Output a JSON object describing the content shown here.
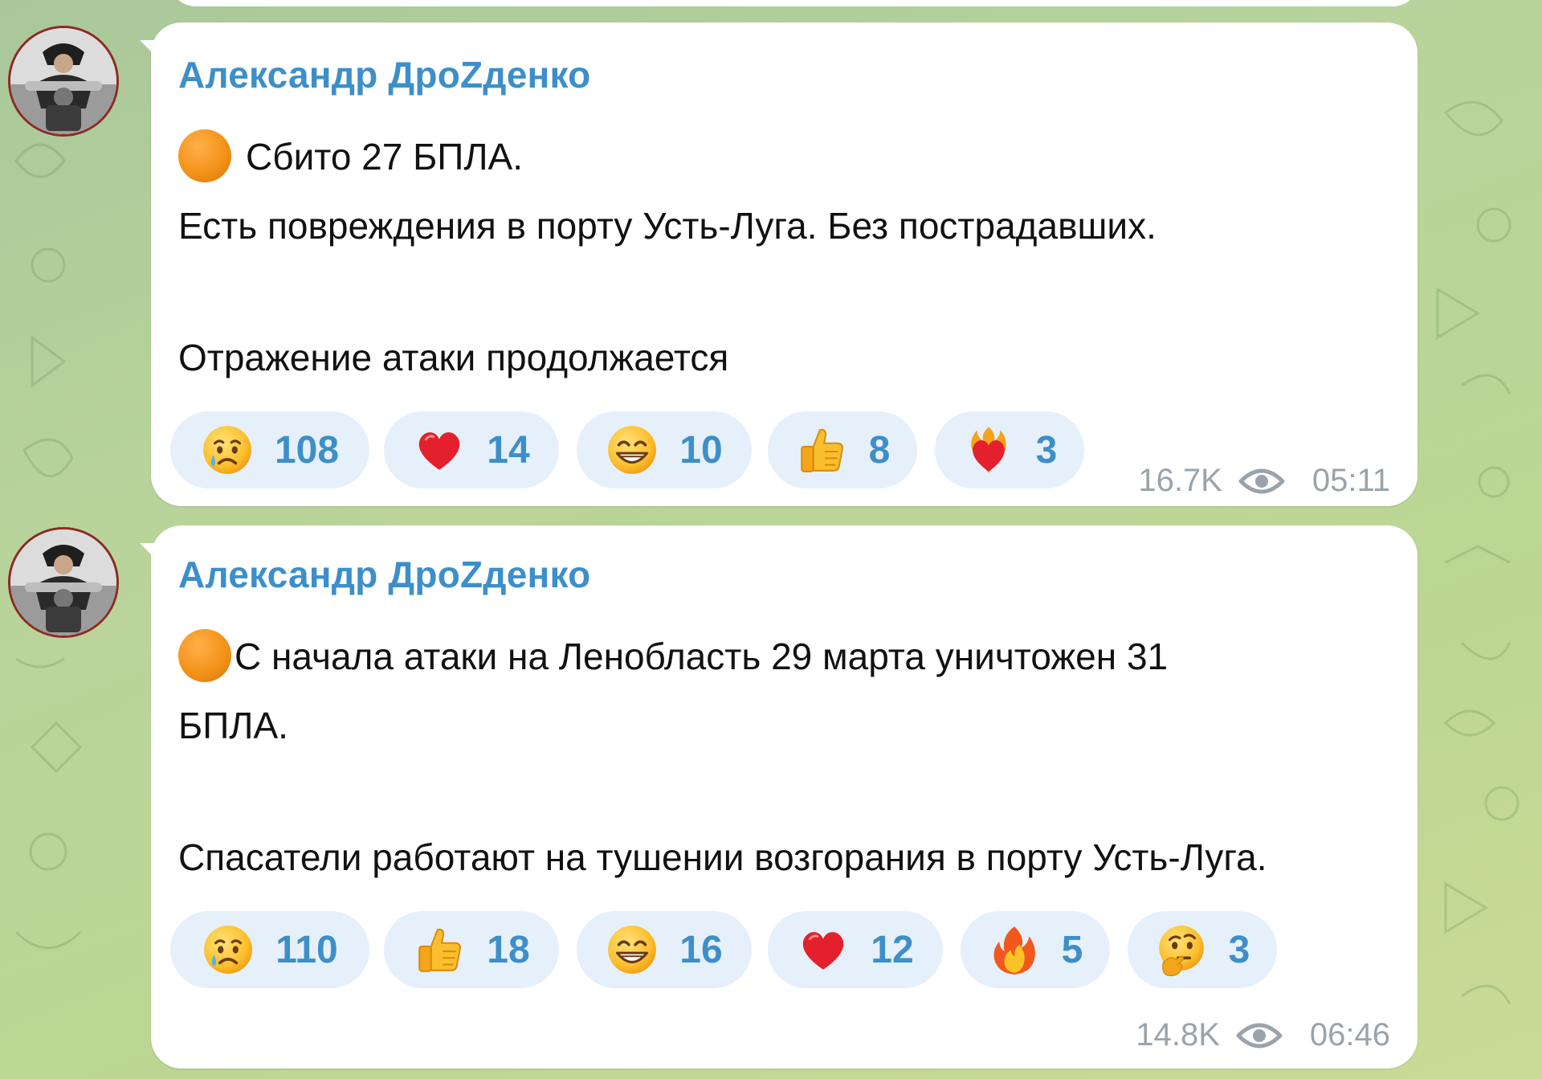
{
  "posts": [
    {
      "author": "Александр ДроZденко",
      "lines": [
        "Сбито 27 БПЛА.",
        "Есть повреждения в порту Усть-Луга. Без пострадавших.",
        "Отражение атаки продолжается"
      ],
      "reactions": [
        {
          "icon": "crying-face-icon",
          "count": "108"
        },
        {
          "icon": "red-heart-icon",
          "count": "14"
        },
        {
          "icon": "grinning-face-icon",
          "count": "10"
        },
        {
          "icon": "thumbs-up-icon",
          "count": "8"
        },
        {
          "icon": "heart-on-fire-icon",
          "count": "3"
        }
      ],
      "views": "16.7K",
      "time": "05:11"
    },
    {
      "author": "Александр ДроZденко",
      "lines": [
        "С начала атаки на Ленобласть 29 марта уничтожен 31",
        "БПЛА.",
        "Спасатели работают на тушении возгорания в порту Усть-Луга."
      ],
      "reactions": [
        {
          "icon": "crying-face-icon",
          "count": "110"
        },
        {
          "icon": "thumbs-up-icon",
          "count": "18"
        },
        {
          "icon": "grinning-face-icon",
          "count": "16"
        },
        {
          "icon": "red-heart-icon",
          "count": "12"
        },
        {
          "icon": "fire-icon",
          "count": "5"
        },
        {
          "icon": "thinking-face-icon",
          "count": "3"
        }
      ],
      "views": "14.8K",
      "time": "06:46"
    }
  ],
  "colors": {
    "author": "#3d8fc9",
    "reaction_bg": "#e6f0fa",
    "reaction_count": "#3d8fc9",
    "meta": "#9aa3ab",
    "status_dot": "#f39319"
  }
}
